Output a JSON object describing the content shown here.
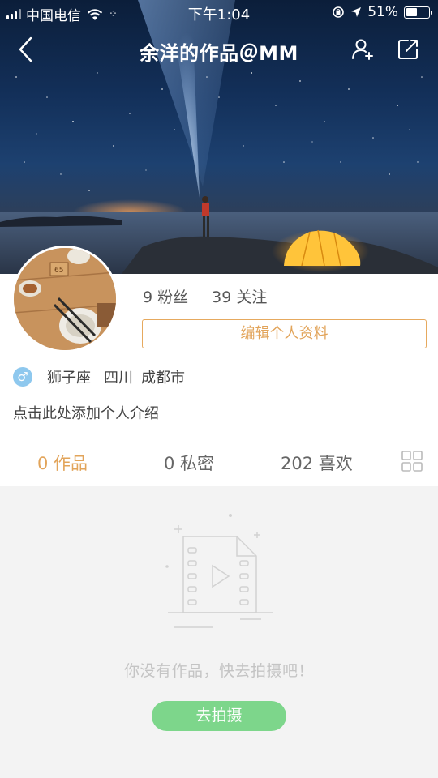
{
  "status_bar": {
    "carrier": "中国电信",
    "time": "下午1:04",
    "battery": "51%",
    "battery_level": 0.51
  },
  "nav": {
    "title": "余洋的作品＠MM"
  },
  "profile": {
    "fans": "9 粉丝",
    "following": "39 关注",
    "edit_label": "编辑个人资料",
    "gender_symbol": "♂",
    "zodiac": "狮子座",
    "province": "四川",
    "city": "成都市",
    "bio_placeholder": "点击此处添加个人介绍"
  },
  "tabs": [
    {
      "label": "0 作品",
      "active": true
    },
    {
      "label": "0 私密",
      "active": false
    },
    {
      "label": "202 喜欢",
      "active": false
    }
  ],
  "empty_state": {
    "message": "你没有作品，快去拍摄吧！",
    "button_label": "去拍摄"
  },
  "colors": {
    "accent": "#e2a45a",
    "button_green": "#7dd68b",
    "gender_blue": "#8ec8ee"
  }
}
